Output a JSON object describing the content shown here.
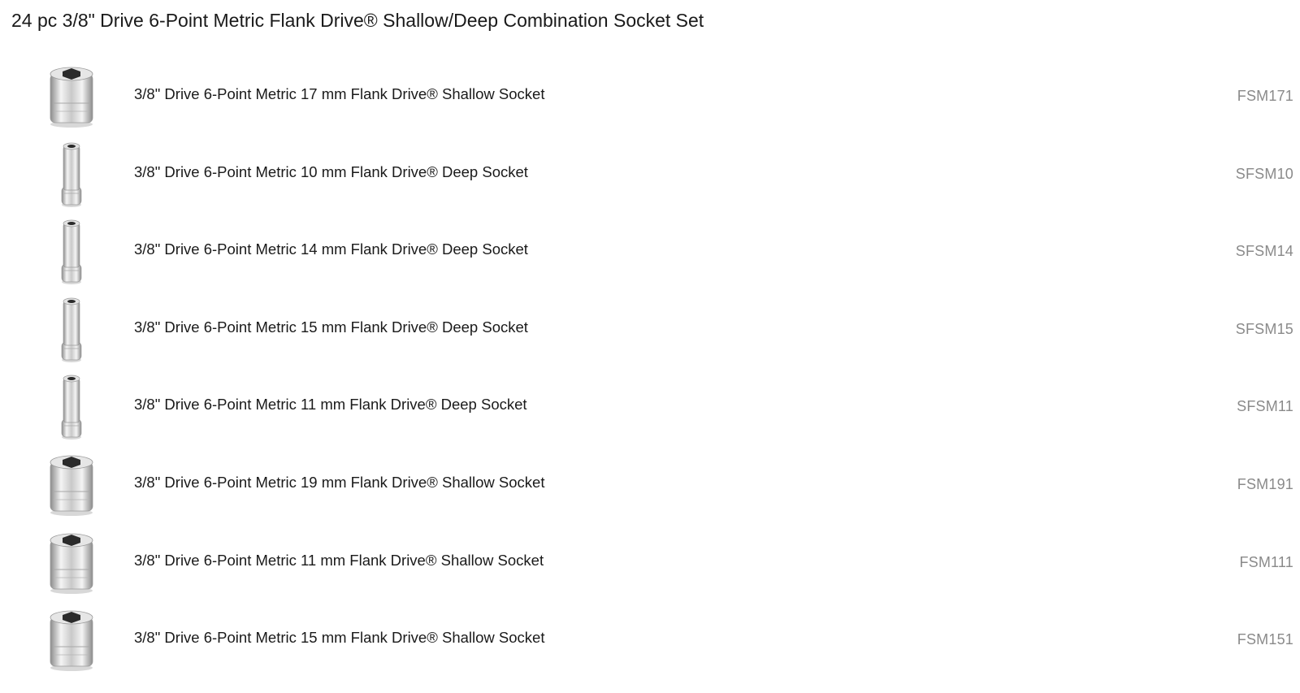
{
  "page": {
    "title": "24 pc 3/8\" Drive 6-Point Metric Flank Drive® Shallow/Deep Combination Socket Set"
  },
  "items": [
    {
      "name": "3/8\" Drive 6-Point Metric 17 mm Flank Drive® Shallow Socket",
      "sku": "FSM171",
      "kind": "shallow"
    },
    {
      "name": "3/8\" Drive 6-Point Metric 10 mm Flank Drive® Deep Socket",
      "sku": "SFSM10",
      "kind": "deep"
    },
    {
      "name": "3/8\" Drive 6-Point Metric 14 mm Flank Drive® Deep Socket",
      "sku": "SFSM14",
      "kind": "deep"
    },
    {
      "name": "3/8\" Drive 6-Point Metric 15 mm Flank Drive® Deep Socket",
      "sku": "SFSM15",
      "kind": "deep"
    },
    {
      "name": "3/8\" Drive 6-Point Metric 11 mm Flank Drive® Deep Socket",
      "sku": "SFSM11",
      "kind": "deep"
    },
    {
      "name": "3/8\" Drive 6-Point Metric 19 mm Flank Drive® Shallow Socket",
      "sku": "FSM191",
      "kind": "shallow"
    },
    {
      "name": "3/8\" Drive 6-Point Metric 11 mm Flank Drive® Shallow Socket",
      "sku": "FSM111",
      "kind": "shallow"
    },
    {
      "name": "3/8\" Drive 6-Point Metric 15 mm Flank Drive® Shallow Socket",
      "sku": "FSM151",
      "kind": "shallow"
    }
  ],
  "icons": {
    "shallow": "shallow-socket-icon",
    "deep": "deep-socket-icon"
  },
  "colors": {
    "text": "#1a1a1a",
    "sku": "#8a8a8a",
    "chrome_light": "#f4f4f4",
    "chrome_mid": "#c9c9c9",
    "chrome_dark": "#8c8c8c"
  }
}
